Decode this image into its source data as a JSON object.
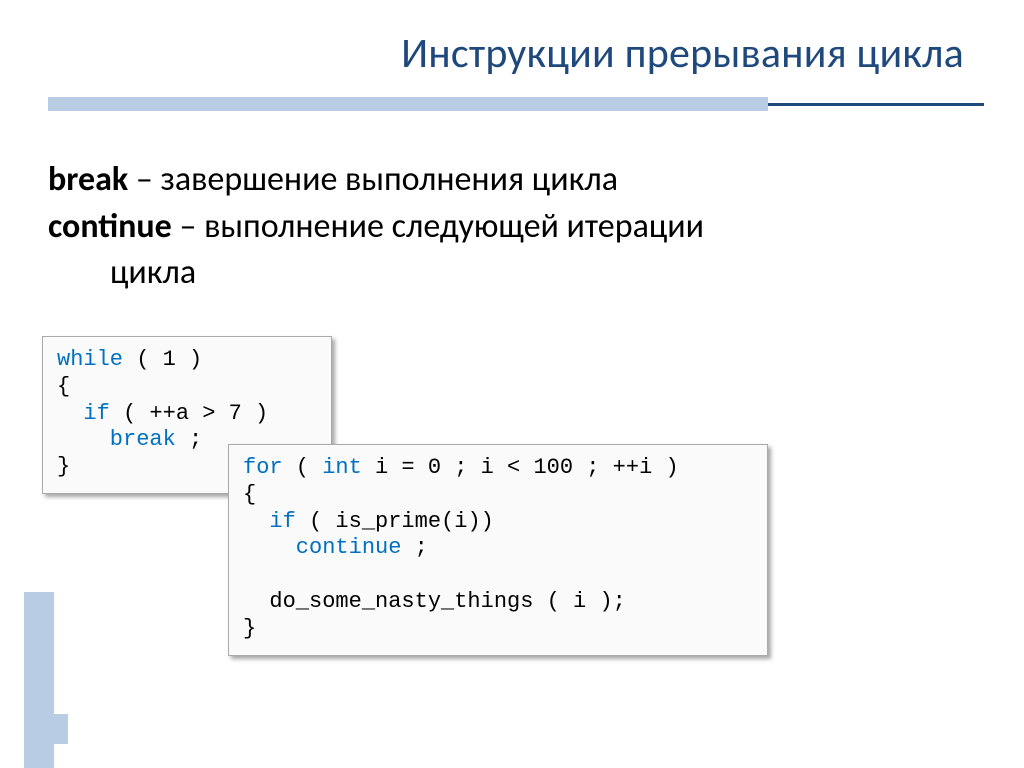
{
  "title": "Инструкции прерывания цикла",
  "body": {
    "break_term": "break",
    "break_desc": " – завершение выполнения цикла",
    "continue_term": "continue",
    "continue_desc": " – выполнение следующей итерации",
    "continue_desc2": "цикла"
  },
  "code1": {
    "l1a": "while",
    "l1b": " ( 1 )",
    "l2": "{",
    "l3a": "  if",
    "l3b": " ( ++a > 7 )",
    "l4a": "    break",
    "l4b": " ;",
    "l5": "}"
  },
  "code2": {
    "l1a": "for",
    "l1b": " ( ",
    "l1c": "int",
    "l1d": " i = 0 ; i < 100 ; ++i )",
    "l2": "{",
    "l3a": "  if",
    "l3b": " ( is_prime(i))",
    "l4a": "    continue",
    "l4b": " ;",
    "l5": "",
    "l6": "  do_some_nasty_things ( i );",
    "l7": "}"
  }
}
